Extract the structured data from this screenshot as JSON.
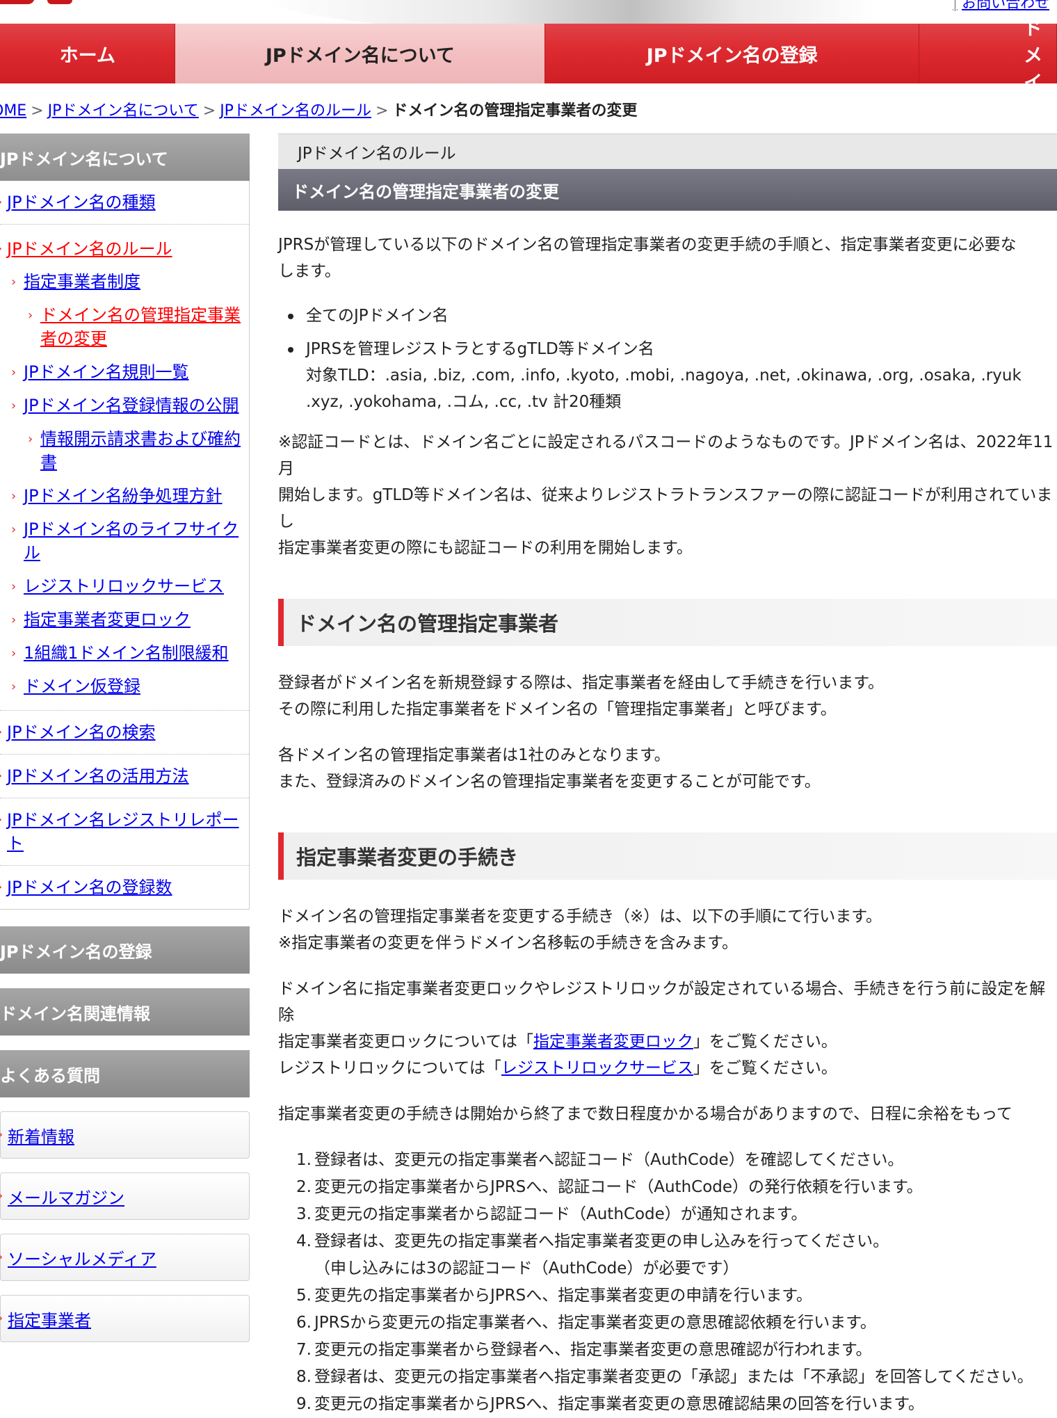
{
  "header": {
    "top_link": "お問い合わせ"
  },
  "nav": {
    "items": [
      "ホーム",
      "JPドメイン名について",
      "JPドメイン名の登録",
      "ドメイ"
    ]
  },
  "breadcrumb": {
    "items": [
      "OME",
      "JPドメイン名について",
      "JPドメイン名のルール"
    ],
    "current": "ドメイン名の管理指定事業者の変更"
  },
  "sidebar": {
    "head": "JPドメイン名について",
    "items": [
      "JPドメイン名の種類",
      "JPドメイン名のルール",
      "指定事業者制度",
      "ドメイン名の管理指定事業者の変更",
      "JPドメイン名規則一覧",
      "JPドメイン名登録情報の公開",
      "情報開示請求書および確約書",
      "JPドメイン名紛争処理方針",
      "JPドメイン名のライフサイクル",
      "レジストリロックサービス",
      "指定事業者変更ロック",
      "1組織1ドメイン名制限緩和",
      "ドメイン仮登録",
      "JPドメイン名の検索",
      "JPドメイン名の活用方法",
      "JPドメイン名レジストリレポート",
      "JPドメイン名の登録数"
    ],
    "sections": [
      "JPドメイン名の登録",
      "ドメイン名関連情報",
      "よくある質問"
    ],
    "boxes": [
      "新着情報",
      "メールマガジン",
      "ソーシャルメディア",
      "指定事業者"
    ]
  },
  "main": {
    "category": "JPドメイン名のルール",
    "title": "ドメイン名の管理指定事業者の変更",
    "intro_1": "JPRSが管理している以下のドメイン名の管理指定事業者の変更手続の手順と、指定事業者変更に必要な",
    "intro_2": "します。",
    "bullet_1": "全てのJPドメイン名",
    "bullet_2": "JPRSを管理レジストラとするgTLD等ドメイン名",
    "bullet_2_line2": "対象TLD：.asia, .biz, .com, .info, .kyoto, .mobi, .nagoya, .net, .okinawa, .org, .osaka, .ryuk",
    "bullet_2_line3": ".xyz, .yokohama, .コム, .cc, .tv 計20種類",
    "note_1": "※認証コードとは、ドメイン名ごとに設定されるパスコードのようなものです。JPドメイン名は、2022年11月",
    "note_2": "開始します。gTLD等ドメイン名は、従来よりレジストラトランスファーの際に認証コードが利用されていまし",
    "note_3": "指定事業者変更の際にも認証コードの利用を開始します。",
    "section_1": "ドメイン名の管理指定事業者",
    "s1_p1_l1": "登録者がドメイン名を新規登録する際は、指定事業者を経由して手続きを行います。",
    "s1_p1_l2": "その際に利用した指定事業者をドメイン名の「管理指定事業者」と呼びます。",
    "s1_p2_l1": "各ドメイン名の管理指定事業者は1社のみとなります。",
    "s1_p2_l2": "また、登録済みのドメイン名の管理指定事業者を変更することが可能です。",
    "section_2": "指定事業者変更の手続き",
    "s2_p1_l1": "ドメイン名の管理指定事業者を変更する手続き（※）は、以下の手順にて行います。",
    "s2_p1_l2": "※指定事業者の変更を伴うドメイン名移転の手続きを含みます。",
    "s2_p2_l1": "ドメイン名に指定事業者変更ロックやレジストリロックが設定されている場合、手続きを行う前に設定を解除",
    "s2_p2_l2_pre": "指定事業者変更ロックについては「",
    "s2_p2_l2_link": "指定事業者変更ロック",
    "s2_p2_l2_post": "」をご覧ください。",
    "s2_p2_l3_pre": "レジストリロックについては「",
    "s2_p2_l3_link": "レジストリロックサービス",
    "s2_p2_l3_post": "」をご覧ください。",
    "s2_p3": "指定事業者変更の手続きは開始から終了まで数日程度かかる場合がありますので、日程に余裕をもって",
    "steps": [
      "登録者は、変更元の指定事業者へ認証コード（AuthCode）を確認してください。",
      "変更元の指定事業者からJPRSへ、認証コード（AuthCode）の発行依頼を行います。",
      "変更元の指定事業者から認証コード（AuthCode）が通知されます。",
      "登録者は、変更先の指定事業者へ指定事業者変更の申し込みを行ってください。",
      "変更先の指定事業者からJPRSへ、指定事業者変更の申請を行います。",
      "JPRSから変更元の指定事業者へ、指定事業者変更の意思確認依頼を行います。",
      "変更元の指定事業者から登録者へ、指定事業者変更の意思確認が行われます。",
      "登録者は、変更元の指定事業者へ指定事業者変更の「承認」または「不承認」を回答してください。",
      "変更元の指定事業者からJPRSへ、指定事業者変更の意思確認結果の回答を行います。"
    ],
    "step_4_sub": "（申し込みには3の認証コード（AuthCode）が必要です）"
  }
}
